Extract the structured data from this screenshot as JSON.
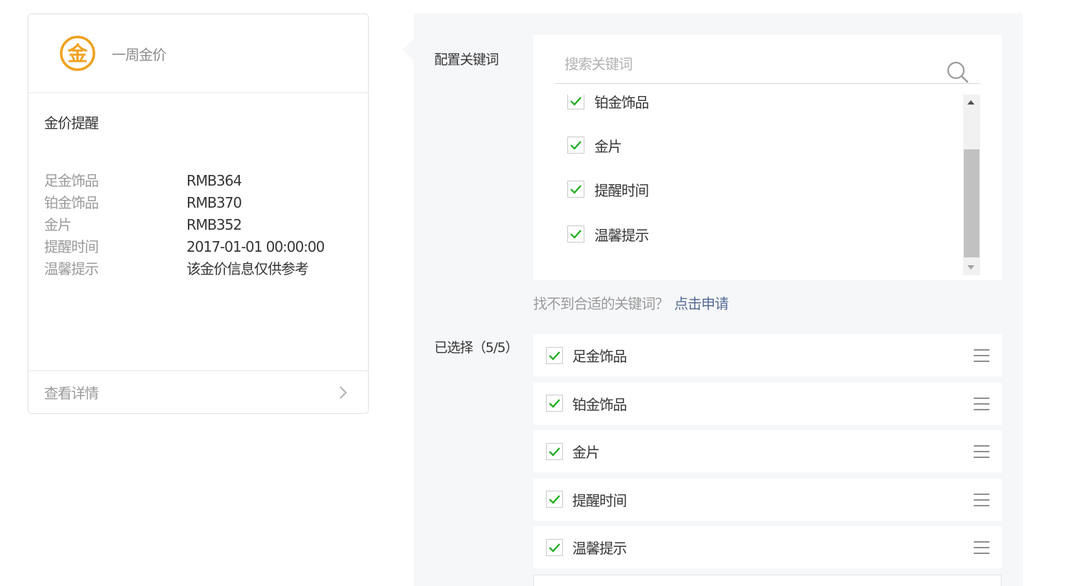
{
  "preview": {
    "account_name": "一周金价",
    "logo_char": "金",
    "logo_color": "#f0a11e",
    "message_title": "金价提醒",
    "fields": [
      {
        "key": "足金饰品",
        "value": "RMB364"
      },
      {
        "key": "铂金饰品",
        "value": "RMB370"
      },
      {
        "key": "金片",
        "value": "RMB352"
      },
      {
        "key": "提醒时间",
        "value": "2017-01-01 00:00:00"
      },
      {
        "key": "温馨提示",
        "value": "该金价信息仅供参考"
      }
    ],
    "footer_link": "查看详情",
    "footer_icon": "chevron-right-icon"
  },
  "config": {
    "keywords_label": "配置关键词",
    "search": {
      "placeholder": "搜索关键词",
      "value": "",
      "icon": "search-icon"
    },
    "keyword_options": [
      {
        "label": "铂金饰品",
        "checked": true
      },
      {
        "label": "金片",
        "checked": true
      },
      {
        "label": "提醒时间",
        "checked": true
      },
      {
        "label": "温馨提示",
        "checked": true
      }
    ],
    "hint_text": "找不到合适的关键词？",
    "apply_link": "点击申请",
    "selected_label": "已选择（5/5）",
    "selected_items": [
      {
        "label": "足金饰品",
        "checked": true
      },
      {
        "label": "铂金饰品",
        "checked": true
      },
      {
        "label": "金片",
        "checked": true
      },
      {
        "label": "提醒时间",
        "checked": true
      },
      {
        "label": "温馨提示",
        "checked": true
      }
    ],
    "check_color": "#1aad19",
    "link_color": "#576b95"
  }
}
